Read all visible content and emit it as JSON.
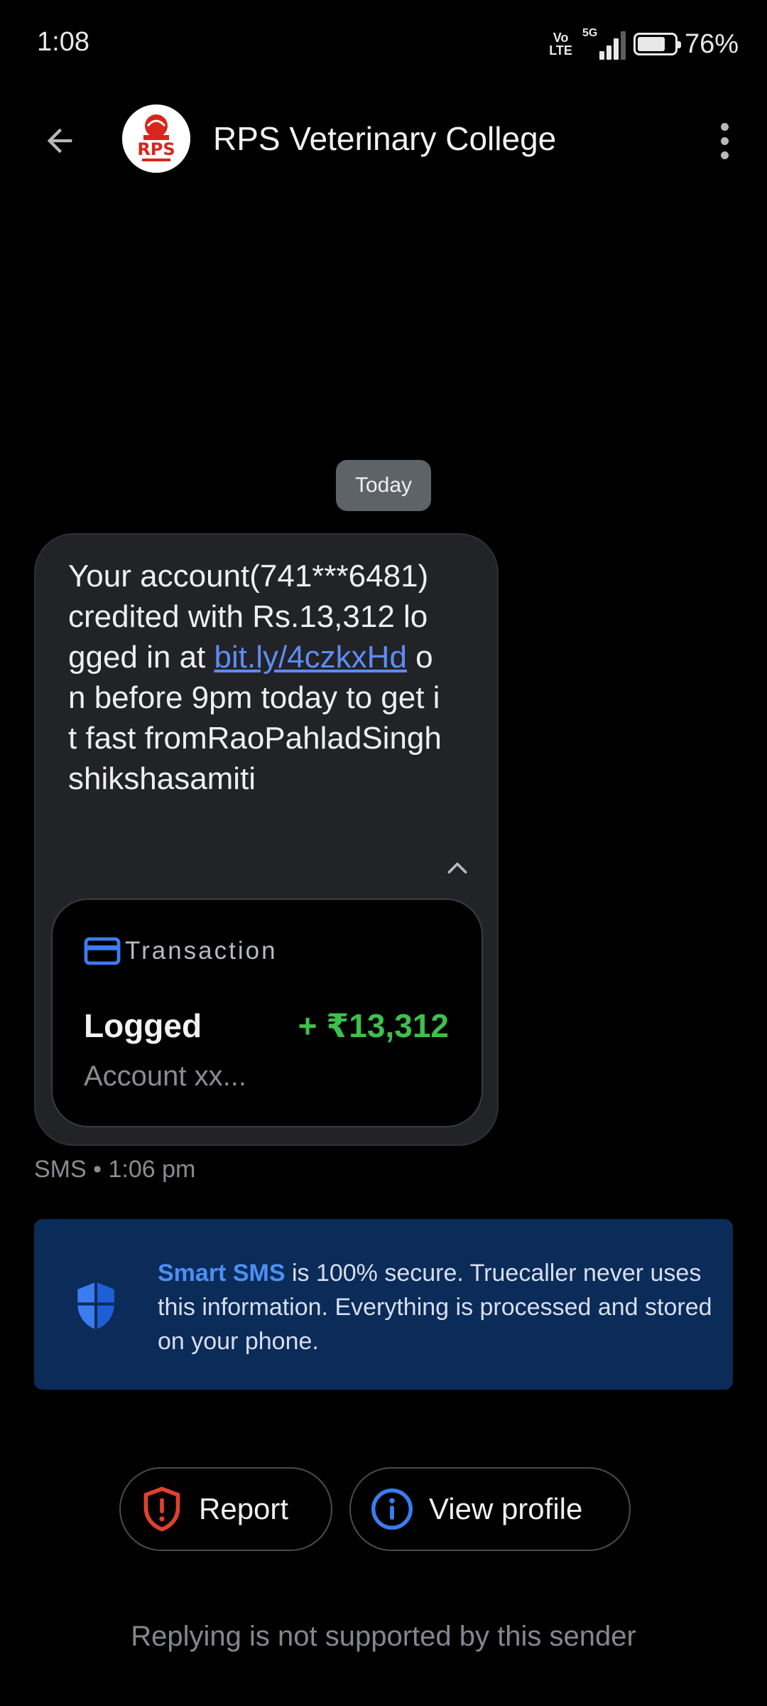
{
  "status_bar": {
    "time": "1:08",
    "volte_top": "Vo",
    "volte_bottom": "LTE",
    "network": "5G",
    "battery_percent": "76%",
    "battery_level": 0.76
  },
  "header": {
    "sender_name": "RPS Veterinary College",
    "avatar_logo_text": "RPS"
  },
  "conversation": {
    "date_chip": "Today",
    "message": {
      "text_before_link": "Your account(741***6481) credited with Rs.13,312 logged in at ",
      "link_text": "bit.ly/4czkxHd",
      "text_after_link": " on before 9pm today to get it fast fromRaoPahladSinghshikshasamiti"
    },
    "transaction_card": {
      "title": "Transaction",
      "label": "Logged",
      "amount": "+ ₹13,312",
      "account": "Account xx..."
    },
    "meta": "SMS • 1:06 pm"
  },
  "banner": {
    "strong_text": "Smart SMS",
    "text": " is 100% secure. Truecaller never uses this information. Everything is processed and stored on your phone."
  },
  "actions": {
    "report_label": "Report",
    "view_profile_label": "View profile"
  },
  "footer_note": "Replying is not supported by this sender",
  "colors": {
    "background": "#000000",
    "bubble": "#222326",
    "link": "#5e8cf6",
    "amount_green": "#3ec04d",
    "banner_bg": "#0b2b58",
    "banner_accent": "#4c8ff5",
    "report_red": "#e0412e",
    "info_blue": "#3b7cf0"
  },
  "icons": {
    "back": "arrow-left-icon",
    "more": "more-vertical-icon",
    "collapse": "chevron-up-icon",
    "transaction": "credit-card-icon",
    "banner": "shield-icon",
    "report": "shield-alert-icon",
    "profile": "info-icon"
  }
}
